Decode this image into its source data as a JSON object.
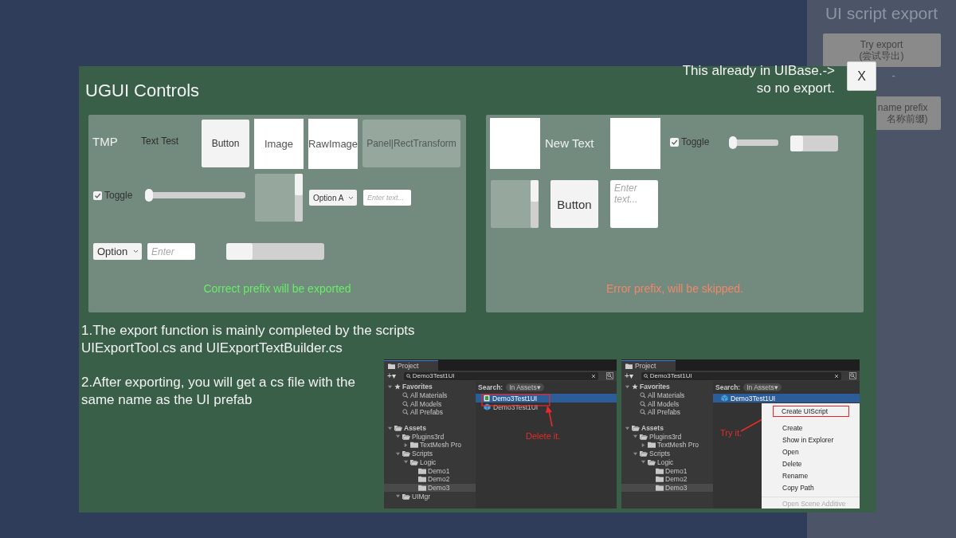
{
  "side_panel": {
    "title": "UI script export",
    "buttons": [
      {
        "label": "Try export",
        "sublabel": "(尝试导出)"
      },
      {
        "label": "name prefix",
        "sublabel": "名称前缀)"
      }
    ],
    "separator": "-"
  },
  "dialog": {
    "title": "UGUI Controls",
    "note": [
      "This already in UIBase.->",
      "so no export."
    ],
    "close": "X"
  },
  "panels": [
    {
      "caption": "Correct prefix will be exported",
      "color": "#66ee66",
      "controls": [
        {
          "kind": "lighttext",
          "text": "TMP"
        },
        {
          "kind": "darktext",
          "text": "Text Test"
        },
        {
          "kind": "button",
          "label": "Button"
        },
        {
          "kind": "image",
          "label": "Image"
        },
        {
          "kind": "image",
          "label": "RawImage"
        },
        {
          "kind": "panel",
          "label": "Panel|RectTransform"
        },
        {
          "kind": "toggle",
          "label": "Toggle",
          "checked": true
        },
        {
          "kind": "slider",
          "level": 0
        },
        {
          "kind": "scrollview"
        },
        {
          "kind": "dropdown",
          "value": "Option A"
        },
        {
          "kind": "input",
          "placeholder": "Enter text..."
        },
        {
          "kind": "dropdown",
          "value": "Option"
        },
        {
          "kind": "input",
          "placeholder": "Enter"
        },
        {
          "kind": "scrollbar"
        }
      ]
    },
    {
      "caption": "Error prefix, will be skipped.",
      "color": "#f08868",
      "controls": [
        {
          "kind": "image"
        },
        {
          "kind": "lighttext",
          "text": "New Text"
        },
        {
          "kind": "image"
        },
        {
          "kind": "toggle",
          "label": "Toggle",
          "checked": true
        },
        {
          "kind": "slider",
          "level": 0
        },
        {
          "kind": "scrollbar"
        },
        {
          "kind": "scrollview"
        },
        {
          "kind": "button",
          "label": "Button"
        },
        {
          "kind": "textarea",
          "placeholder": "Enter text..."
        }
      ]
    }
  ],
  "help": [
    "1.The export function is mainly completed by the scripts UIExportTool.cs and UIExportTextBuilder.cs",
    "2.After exporting, you will get a cs file with the same name as the UI prefab"
  ],
  "screenshots": [
    {
      "tab": "Project",
      "add": "+▾",
      "search": "Demo3Test1UI",
      "filter_label": "Search:",
      "filter": "In Assets▾",
      "tree": [
        {
          "label": "Favorites",
          "expanded": true,
          "selected": false,
          "children": [
            {
              "label": "All Materials",
              "selected": false
            },
            {
              "label": "All Models",
              "selected": false
            },
            {
              "label": "All Prefabs",
              "selected": false
            }
          ]
        },
        {
          "label": "Assets",
          "expanded": true,
          "selected": false,
          "children": [
            {
              "label": "Plugins3rd",
              "expanded": true,
              "selected": false,
              "children": [
                {
                  "label": "TextMesh Pro",
                  "expanded": false,
                  "selected": false
                }
              ]
            },
            {
              "label": "Scripts",
              "expanded": true,
              "selected": false,
              "children": [
                {
                  "label": "Logic",
                  "expanded": true,
                  "selected": false,
                  "children": [
                    {
                      "label": "Demo1",
                      "selected": false
                    },
                    {
                      "label": "Demo2",
                      "selected": false
                    },
                    {
                      "label": "Demo3",
                      "selected": true
                    }
                  ]
                }
              ]
            },
            {
              "label": "UIMgr",
              "expanded": true,
              "selected": false
            }
          ]
        }
      ],
      "results": [
        {
          "label": "Demo3Test1UI",
          "selected": true
        },
        {
          "label": "Demo3Test1UI",
          "selected": false
        }
      ],
      "callout": "Delete it."
    },
    {
      "tab": "Project",
      "add": "+▾",
      "search": "Demo3Test1UI",
      "filter_label": "Search:",
      "filter": "In Assets▾",
      "tree": [
        {
          "label": "Favorites",
          "expanded": true,
          "selected": false,
          "children": [
            {
              "label": "All Materials",
              "selected": false
            },
            {
              "label": "All Models",
              "selected": false
            },
            {
              "label": "All Prefabs",
              "selected": false
            }
          ]
        },
        {
          "label": "Assets",
          "expanded": true,
          "selected": false,
          "children": [
            {
              "label": "Plugins3rd",
              "expanded": true,
              "selected": false,
              "children": [
                {
                  "label": "TextMesh Pro",
                  "expanded": false,
                  "selected": false
                }
              ]
            },
            {
              "label": "Scripts",
              "expanded": true,
              "selected": false,
              "children": [
                {
                  "label": "Logic",
                  "expanded": true,
                  "selected": false,
                  "children": [
                    {
                      "label": "Demo1",
                      "selected": false
                    },
                    {
                      "label": "Demo2",
                      "selected": false
                    },
                    {
                      "label": "Demo3",
                      "selected": true
                    }
                  ]
                }
              ]
            }
          ]
        }
      ],
      "results": [
        {
          "label": "Demo3Test1UI",
          "selected": true
        }
      ],
      "callout": "Try it.",
      "menu": [
        {
          "label": "Create UIScript",
          "disabled": false
        },
        {
          "label": "Create",
          "disabled": false
        },
        {
          "label": "Show in Explorer",
          "disabled": false
        },
        {
          "label": "Open",
          "disabled": false
        },
        {
          "label": "Delete",
          "disabled": false
        },
        {
          "label": "Rename",
          "disabled": false
        },
        {
          "label": "Copy Path",
          "disabled": false
        },
        {
          "label": "Open Scene Additive",
          "disabled": true
        }
      ]
    }
  ]
}
